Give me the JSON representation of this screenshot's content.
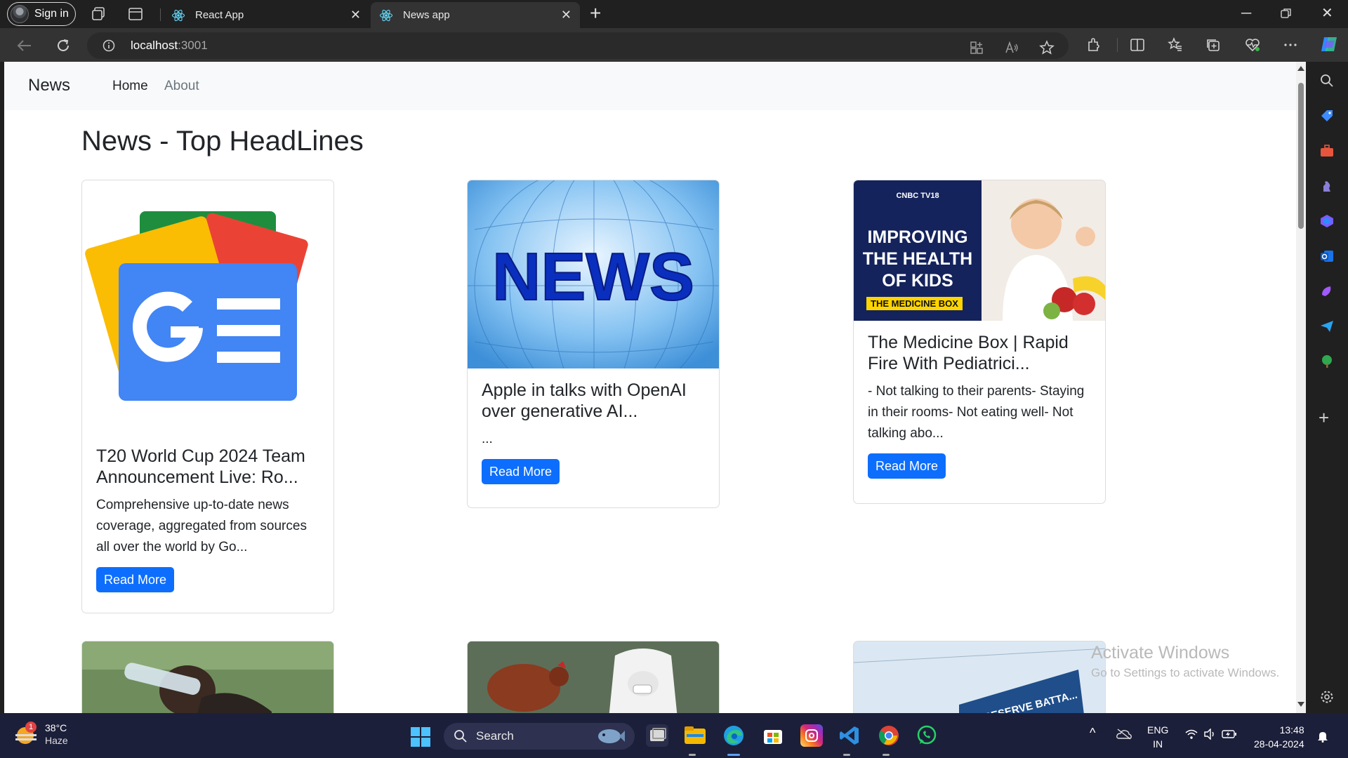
{
  "browser": {
    "signin_label": "Sign in",
    "tabs": [
      {
        "title": "React App",
        "active": false
      },
      {
        "title": "News app",
        "active": true
      }
    ],
    "url_host": "localhost",
    "url_port": ":3001"
  },
  "page": {
    "brand": "News",
    "nav": [
      {
        "label": "Home",
        "active": true
      },
      {
        "label": "About",
        "active": false
      }
    ],
    "heading": "News - Top HeadLines",
    "articles": [
      {
        "title": "T20 World Cup 2024 Team Announcement Live: Ro...",
        "description": "Comprehensive up-to-date news coverage, aggregated from sources all over the world by Go...",
        "button": "Read More",
        "image": "google-news-logo"
      },
      {
        "title": "Apple in talks with OpenAI over generative AI...",
        "description": "...",
        "button": "Read More",
        "image": "news-globe"
      },
      {
        "title": "The Medicine Box | Rapid Fire With Pediatrici...",
        "description": "- Not talking to their parents- Staying in their rooms- Not eating well- Not talking abo...",
        "button": "Read More",
        "image": "cnbc-medicine-box",
        "image_text": {
          "logo": "CNBC TV18",
          "headline": "IMPROVING THE HEALTH OF KIDS",
          "tag": "THE MEDICINE BOX"
        }
      }
    ],
    "second_row_images": [
      "person-drinking-water",
      "hen-and-health-worker",
      "reserve-battalion-sign"
    ],
    "second_row_sign_text": "RESERVE BATTA..."
  },
  "watermark": {
    "line1": "Activate Windows",
    "line2": "Go to Settings to activate Windows."
  },
  "taskbar": {
    "weather_temp": "38°C",
    "weather_desc": "Haze",
    "weather_badge": "1",
    "search_label": "Search",
    "language": "ENG",
    "region": "IN",
    "time": "13:48",
    "date": "28-04-2024"
  },
  "colors": {
    "primary_button": "#0d6efd",
    "navbar_bg": "#f8f9fa",
    "browser_frame": "#202020",
    "taskbar_bg": "#1c1f3a"
  }
}
